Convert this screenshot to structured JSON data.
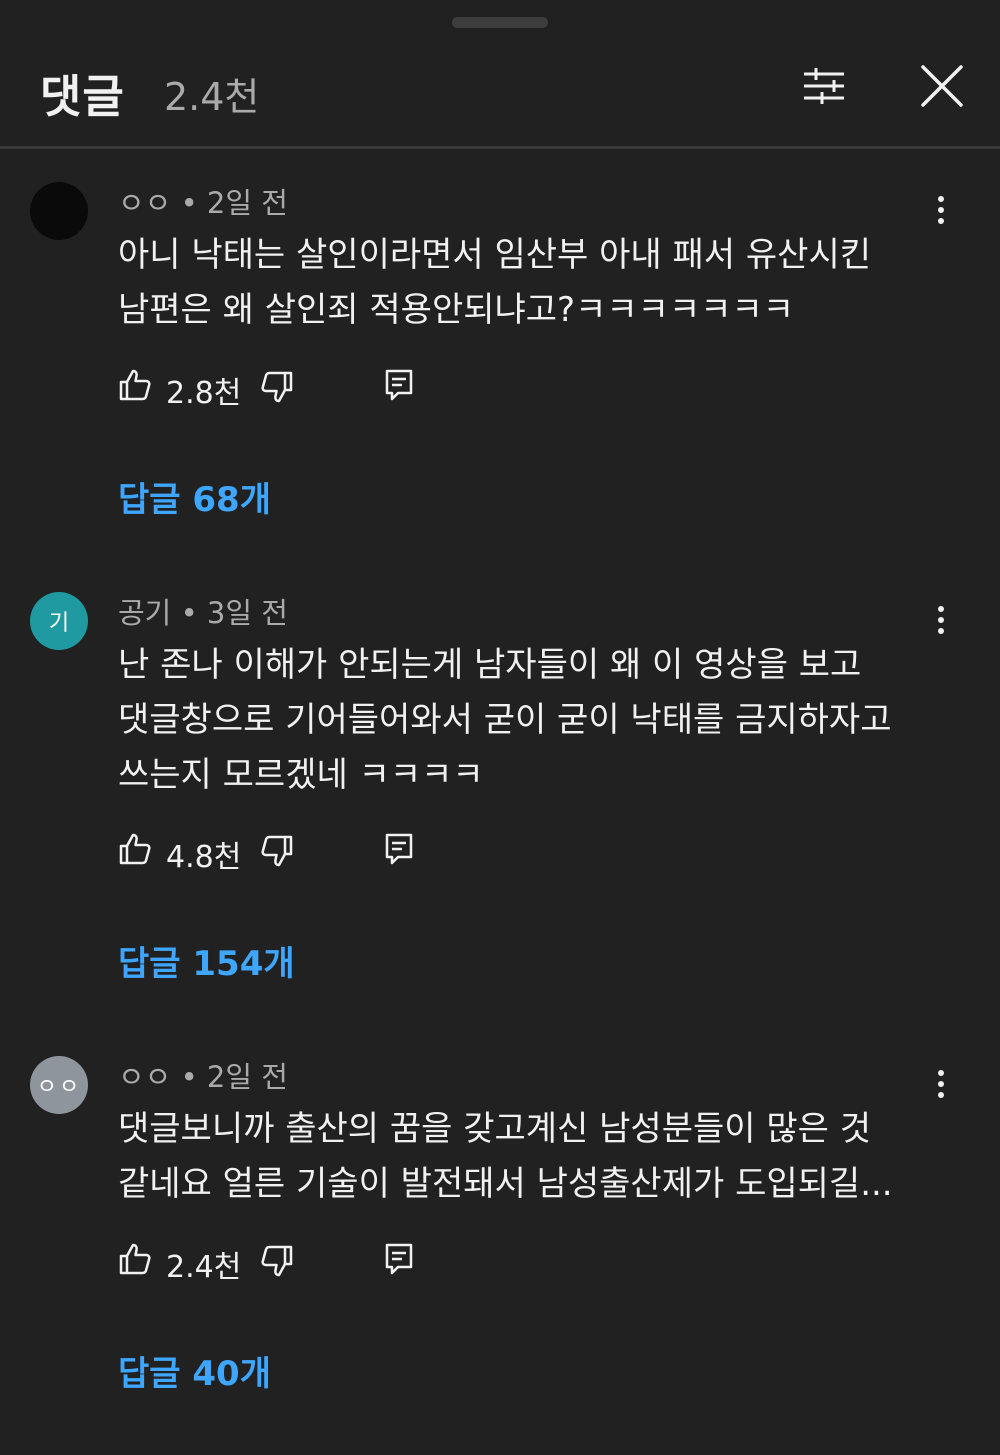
{
  "header": {
    "title": "댓글",
    "count": "2.4천"
  },
  "comments": [
    {
      "author": "ㅇㅇ",
      "time": "2일 전",
      "avatar_text": "",
      "text": "아니 낙태는 살인이라면서 임산부 아내 패서 유산시킨\n남편은 왜 살인죄 적용안되냐고?ㅋㅋㅋㅋㅋㅋㅋ",
      "likes": "2.8천",
      "replies": "답글 68개"
    },
    {
      "author": "공기",
      "time": "3일 전",
      "avatar_text": "기",
      "text": "난 존나 이해가 안되는게 남자들이 왜 이 영상을 보고\n댓글창으로 기어들어와서 굳이 굳이 낙태를 금지하자고\n쓰는지 모르겠네 ㅋㅋㅋㅋ",
      "likes": "4.8천",
      "replies": "답글 154개"
    },
    {
      "author": "ㅇㅇ",
      "time": "2일 전",
      "avatar_text": "ㅇㅇ",
      "text": "댓글보니까 출산의 꿈을 갖고계신 남성분들이 많은 것\n같네요 얼른 기술이 발전돼서 남성출산제가 도입되길...",
      "likes": "2.4천",
      "replies": "답글 40개"
    }
  ],
  "colors": {
    "background": "#212121",
    "text": "#f1f1f1",
    "secondary_text": "#aaaaaa",
    "link": "#3ea6ff",
    "avatar_teal": "#1e9aa0",
    "avatar_gray": "#8e959c"
  },
  "icons": [
    "filter-icon",
    "close-icon",
    "kebab-menu-icon",
    "thumbs-up-icon",
    "thumbs-down-icon",
    "reply-icon"
  ]
}
